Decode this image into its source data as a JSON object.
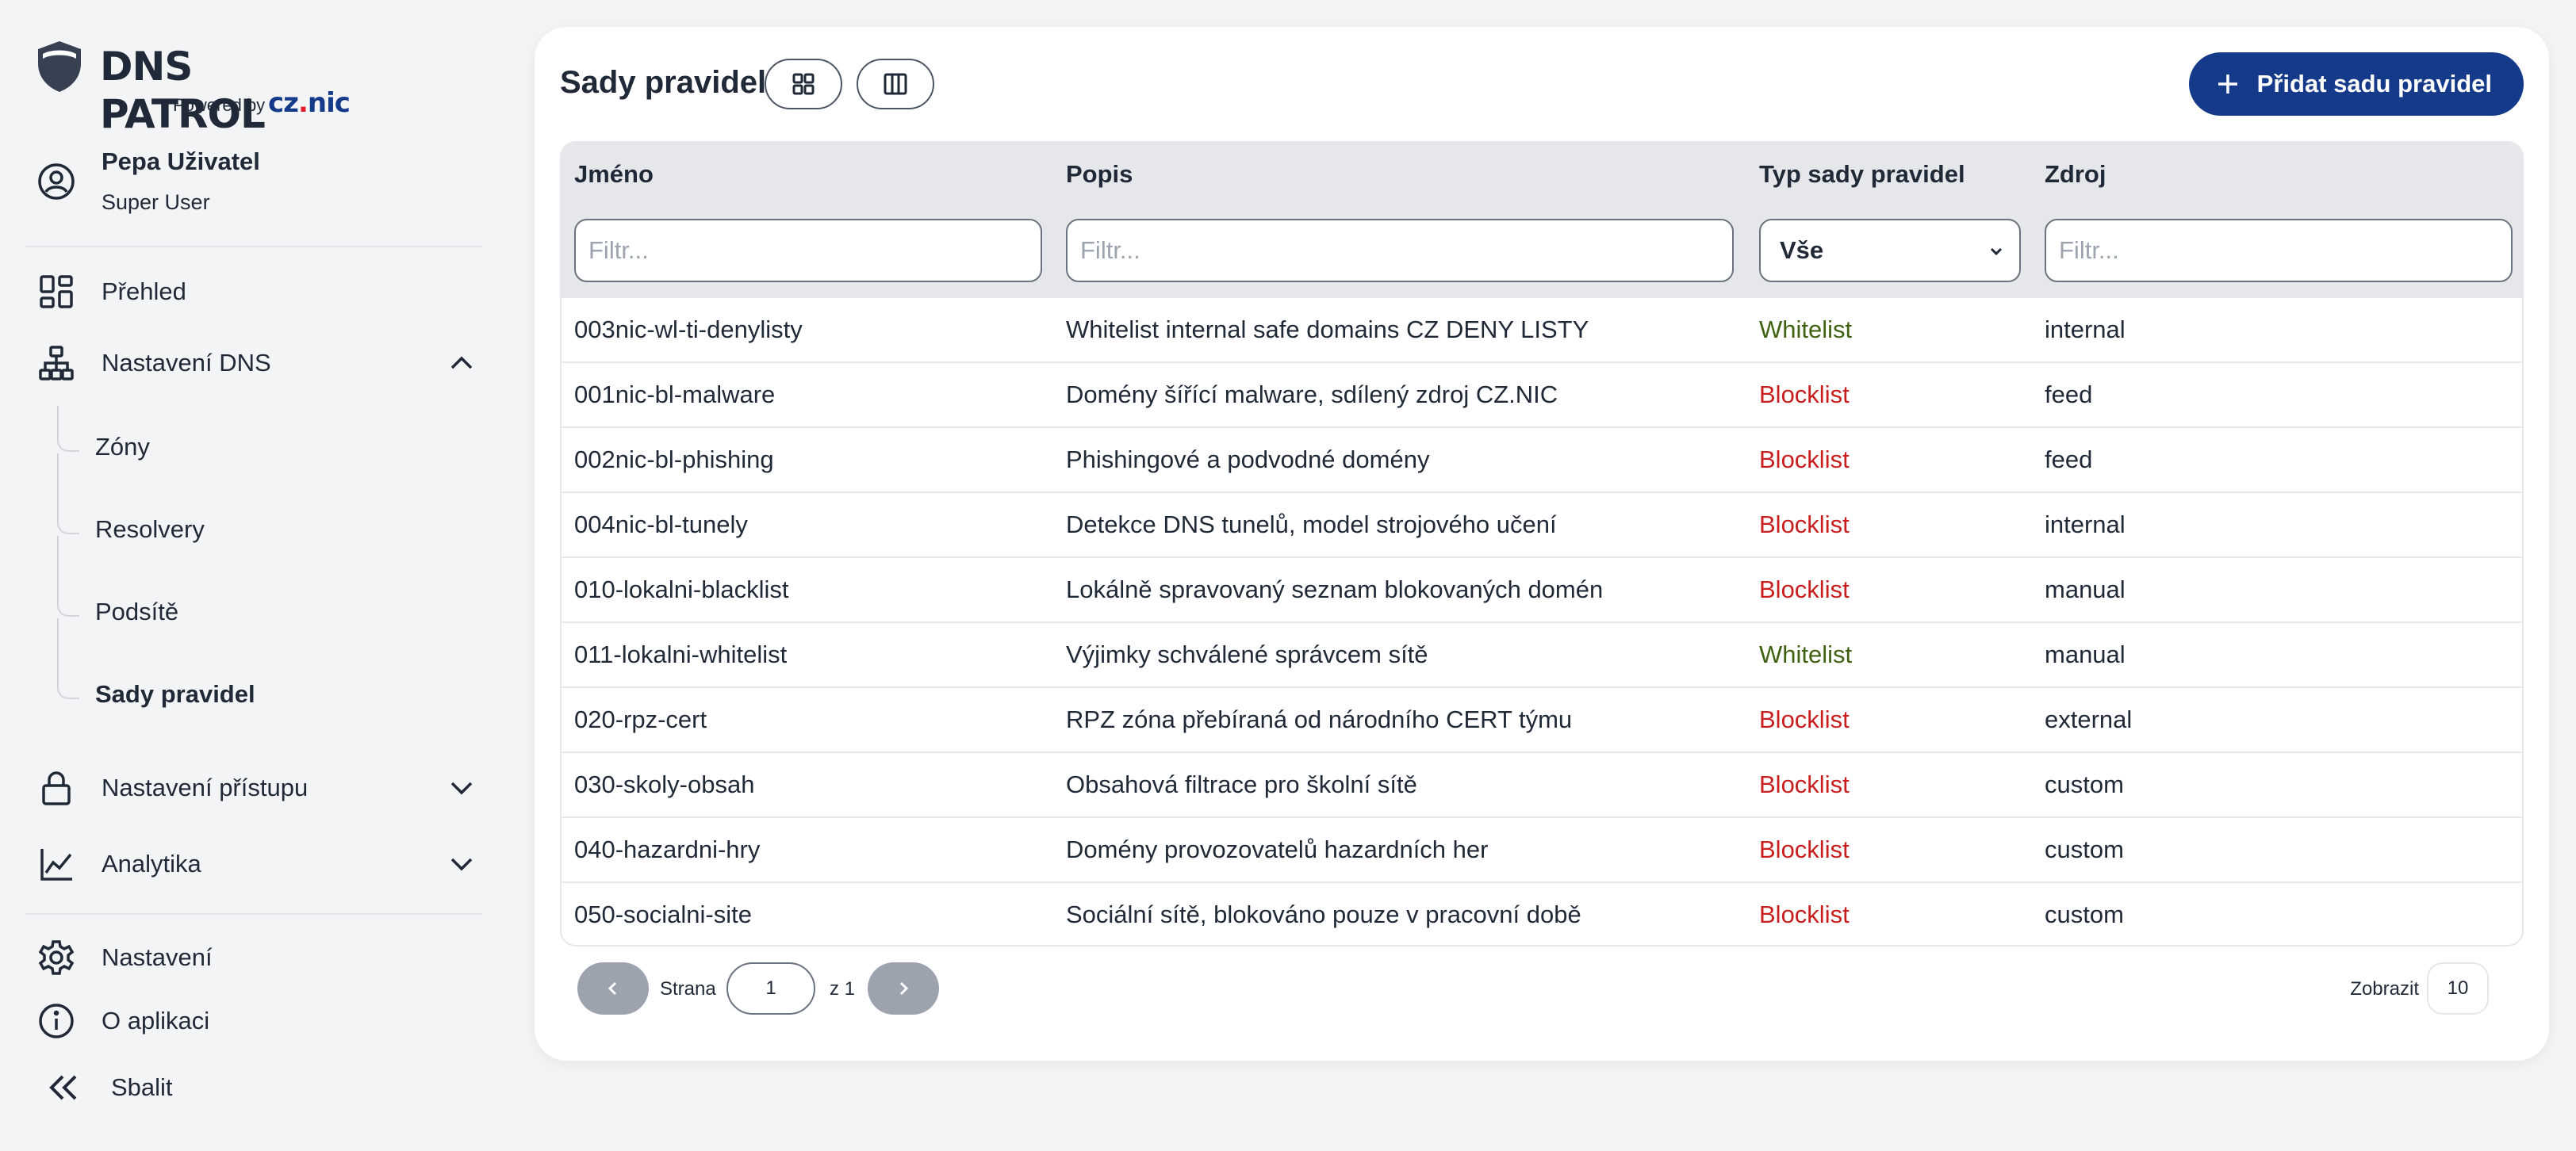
{
  "brand": {
    "name": "DNS PATROL",
    "powered_by": "Powered by",
    "company_part1": "cz",
    "company_dot": ".",
    "company_part2": "nic"
  },
  "user": {
    "name": "Pepa Uživatel",
    "role": "Super User"
  },
  "nav": {
    "overview": "Přehled",
    "dns_settings": "Nastavení DNS",
    "dns_sub": [
      "Zóny",
      "Resolvery",
      "Podsítě",
      "Sady pravidel"
    ],
    "access_settings": "Nastavení přístupu",
    "analytics": "Analytika",
    "settings": "Nastavení",
    "about": "O aplikaci",
    "collapse": "Sbalit"
  },
  "main": {
    "title": "Sady pravidel",
    "add_button": "Přidat sadu pravidel",
    "columns": [
      "Jméno",
      "Popis",
      "Typ sady pravidel",
      "Zdroj"
    ],
    "filter_placeholder": "Filtr...",
    "type_filter_value": "Vše",
    "rows": [
      {
        "name": "003nic-wl-ti-denylisty",
        "desc": "Whitelist internal safe domains CZ DENY LISTY",
        "type": "Whitelist",
        "source": "internal"
      },
      {
        "name": "001nic-bl-malware",
        "desc": "Domény šířící malware, sdílený zdroj CZ.NIC",
        "type": "Blocklist",
        "source": "feed"
      },
      {
        "name": "002nic-bl-phishing",
        "desc": "Phishingové a podvodné domény",
        "type": "Blocklist",
        "source": "feed"
      },
      {
        "name": "004nic-bl-tunely",
        "desc": "Detekce DNS tunelů, model strojového učení",
        "type": "Blocklist",
        "source": "internal"
      },
      {
        "name": "010-lokalni-blacklist",
        "desc": "Lokálně spravovaný seznam blokovaných domén",
        "type": "Blocklist",
        "source": "manual"
      },
      {
        "name": "011-lokalni-whitelist",
        "desc": "Výjimky schválené správcem sítě",
        "type": "Whitelist",
        "source": "manual"
      },
      {
        "name": "020-rpz-cert",
        "desc": "RPZ zóna přebíraná od národního CERT týmu",
        "type": "Blocklist",
        "source": "external"
      },
      {
        "name": "030-skoly-obsah",
        "desc": "Obsahová filtrace pro školní sítě",
        "type": "Blocklist",
        "source": "custom"
      },
      {
        "name": "040-hazardni-hry",
        "desc": "Domény provozovatelů hazardních her",
        "type": "Blocklist",
        "source": "custom"
      },
      {
        "name": "050-socialni-site",
        "desc": "Sociální sítě, blokováno pouze v pracovní době",
        "type": "Blocklist",
        "source": "custom"
      }
    ],
    "pagination": {
      "page_label": "Strana",
      "page_value": "1",
      "of_label": "z 1",
      "show_label": "Zobrazit",
      "show_value": "10"
    }
  },
  "colors": {
    "whitelist": "#3f6212",
    "blocklist": "#c81e1e",
    "primary": "#163a8a"
  }
}
